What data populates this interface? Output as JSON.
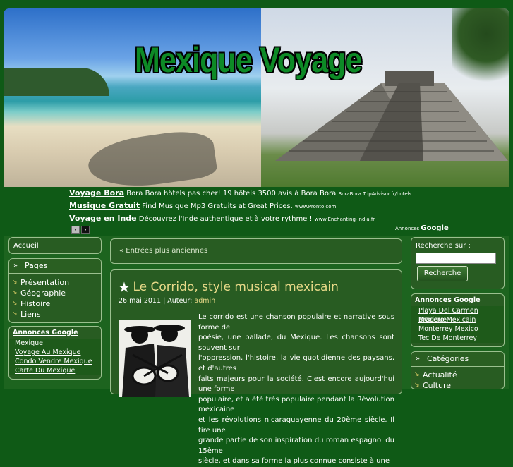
{
  "site": {
    "title": "Mexique Voyage"
  },
  "colors": {
    "background": "#0f5a16",
    "panel": "#285c22",
    "accent": "#e7d988",
    "title_green": "#0d8a26"
  },
  "ads": [
    {
      "title": "Voyage Bora",
      "text": "Bora Bora hôtels pas cher! 19 hôtels 3500 avis à Bora Bora",
      "url": "BoraBora.TripAdvisor.fr/hotels"
    },
    {
      "title": "Musique Gratuit",
      "text": "Find Musique Mp3 Gratuits at Great Prices.",
      "url": "www.Pronto.com"
    },
    {
      "title": "Voyage en Inde",
      "text": "Découvrez l'Inde authentique et à votre rythme !",
      "url": "www.Enchanting-India.fr"
    }
  ],
  "ads_label": {
    "prefix": "Annonces",
    "brand": "Google"
  },
  "ad_nav": {
    "prev": "‹",
    "next": "›"
  },
  "left": {
    "home": "Accueil",
    "pages_title": "Pages",
    "pages": [
      "Présentation",
      "Géographie",
      "Histoire",
      "Liens"
    ],
    "google_ads_title": "Annonces Google",
    "google_ads": [
      "Mexique",
      "Voyage Au Mexique",
      "Condo Vendre Mexique",
      "Carte Du Mexique"
    ]
  },
  "main": {
    "older_link": "« Entrées plus anciennes",
    "post": {
      "title": "Le Corrido, style musical mexicain",
      "date": "26 mai 2011",
      "author_label": "| Auteur:",
      "author": "admin",
      "lines": [
        "Le corrido est une chanson populaire et narrative sous forme de",
        "poésie, une ballade, du Mexique. Les chansons sont souvent sur",
        "l'oppression, l'histoire, la vie quotidienne des paysans, et d'autres",
        "faits majeurs pour la société. C'est encore aujourd'hui une forme",
        "populaire, et a été très populaire pendant la Révolution mexicaine",
        "et les révolutions nicaraguayenne du 20ème siècle. Il tire une",
        "grande partie de son inspiration du roman espagnol du 15ème",
        "siècle, et dans sa forme la plus connue consiste à une"
      ]
    }
  },
  "right": {
    "search_label": "Recherche sur :",
    "search_value": "",
    "search_button": "Recherche",
    "google_ads_title": "Annonces Google",
    "google_ads": [
      "Playa Del Carmen Mexique",
      "Brasero Mexicain",
      "Monterrey Mexico",
      "Tec De Monterrey"
    ],
    "categories_title": "Catégories",
    "categories": [
      "Actualité",
      "Culture"
    ]
  }
}
